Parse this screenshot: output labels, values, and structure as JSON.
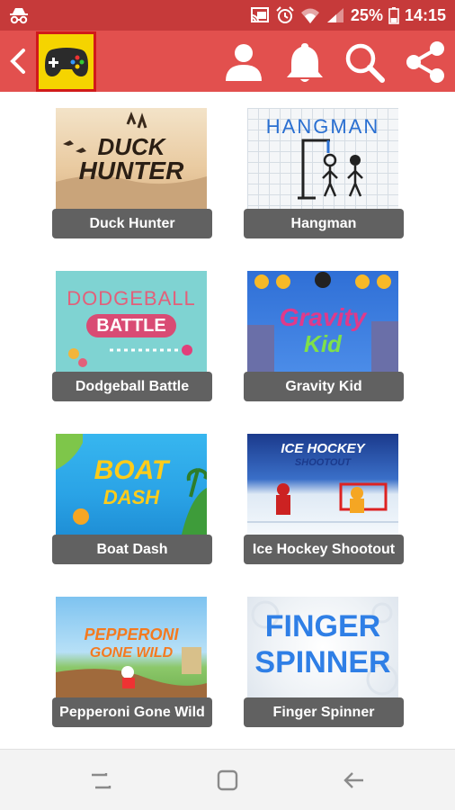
{
  "status_bar": {
    "battery": "25%",
    "time": "14:15",
    "icons": [
      "incognito-icon",
      "cast-icon",
      "alarm-icon",
      "wifi-icon",
      "signal-icon",
      "battery-icon"
    ]
  },
  "app_bar": {
    "background": "#e2504e",
    "logo_background": "#f5d400",
    "icons": [
      "back-icon",
      "gamepad-logo-icon",
      "profile-icon",
      "bell-icon",
      "search-icon",
      "share-icon"
    ]
  },
  "games": [
    {
      "label": "Duck Hunter",
      "art_text": [
        "DUCK",
        "HUNTER"
      ]
    },
    {
      "label": "Hangman",
      "art_text": [
        "HANGMAN"
      ]
    },
    {
      "label": "Dodgeball Battle",
      "art_text": [
        "DODGEBALL",
        "BATTLE"
      ]
    },
    {
      "label": "Gravity Kid",
      "art_text": [
        "Gravity",
        "Kid"
      ]
    },
    {
      "label": "Boat Dash",
      "art_text": [
        "BOAT",
        "DASH"
      ]
    },
    {
      "label": "Ice Hockey Shootout",
      "art_text": [
        "ICE HOCKEY",
        "SHOOTOUT"
      ]
    },
    {
      "label": "Pepperoni Gone Wild",
      "art_text": [
        "PEPPERONI",
        "GONE WILD"
      ]
    },
    {
      "label": "Finger Spinner",
      "art_text": [
        "FINGER",
        "SPINNER"
      ]
    }
  ],
  "nav_bar": {
    "icons": [
      "recent-apps-icon",
      "home-icon",
      "back-nav-icon"
    ]
  }
}
